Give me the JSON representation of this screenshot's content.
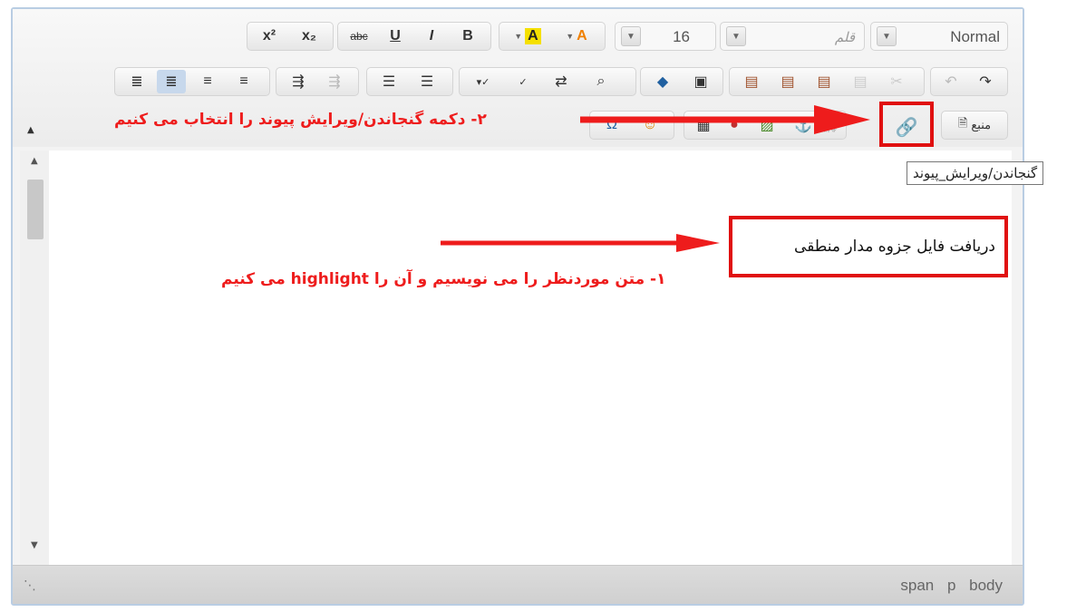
{
  "toolbar": {
    "row1": {
      "superscript_label": "x²",
      "subscript_label": "x₂",
      "strikethrough_label": "abc",
      "underline_label": "U",
      "italic_label": "I",
      "bold_label": "B",
      "text_color_label": "A",
      "bg_color_label": "A",
      "font_size_value": "16",
      "font_placeholder": "قلم",
      "format_value": "Normal"
    },
    "row3": {
      "source_label": "منبع"
    }
  },
  "tooltip": {
    "text": "گنجاندن/ویرایش_پیوند"
  },
  "editor": {
    "content_text": "دریافت فایل جزوه مدار منطقی"
  },
  "statusbar": {
    "path": "span p body"
  },
  "annotations": {
    "step1": "۱- متن موردنظر را می نویسیم و آن را highlight می کنیم",
    "step2": "۲- دکمه گنجاندن/ویرایش پیوند را انتخاب می کنیم"
  },
  "colors": {
    "annotation": "#ee1c1c",
    "toolbar_active": "#c7d8ec",
    "editor_border": "#b9cde3"
  }
}
